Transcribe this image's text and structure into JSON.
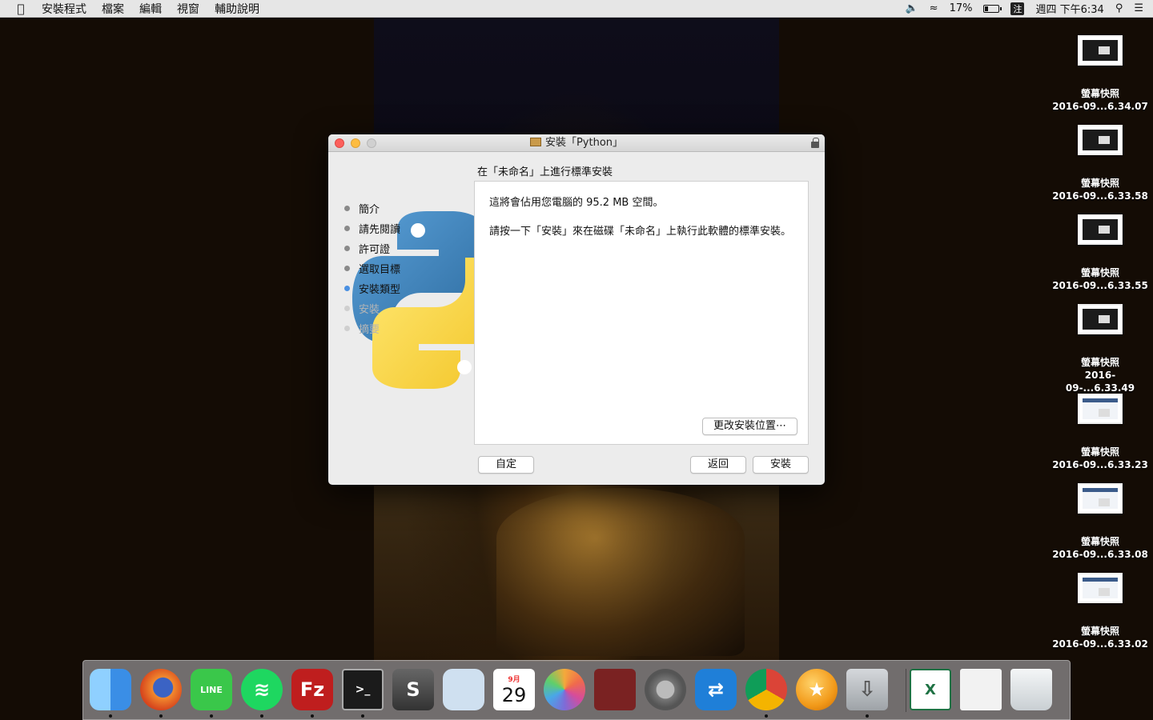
{
  "menubar": {
    "items": [
      "安裝程式",
      "檔案",
      "編輯",
      "視窗",
      "輔助說明"
    ],
    "battery_percent": "17%",
    "battery_level": 0.17,
    "ime_label": "注",
    "clock": "週四 下午6:34"
  },
  "desktop": {
    "icons": [
      {
        "name": "螢幕快照",
        "file": "2016-09...6.34.07",
        "style": "dark"
      },
      {
        "name": "螢幕快照",
        "file": "2016-09...6.33.58",
        "style": "dark"
      },
      {
        "name": "螢幕快照",
        "file": "2016-09...6.33.55",
        "style": "dark"
      },
      {
        "name": "螢幕快照",
        "file": "2016-09-...6.33.49",
        "style": "dark"
      },
      {
        "name": "螢幕快照",
        "file": "2016-09...6.33.23",
        "style": "light"
      },
      {
        "name": "螢幕快照",
        "file": "2016-09...6.33.08",
        "style": "light"
      },
      {
        "name": "螢幕快照",
        "file": "2016-09...6.33.02",
        "style": "light"
      }
    ]
  },
  "window": {
    "title": "安裝「Python」",
    "steps": [
      {
        "label": "簡介",
        "state": "done"
      },
      {
        "label": "請先閱讀",
        "state": "done"
      },
      {
        "label": "許可證",
        "state": "done"
      },
      {
        "label": "選取目標",
        "state": "done"
      },
      {
        "label": "安裝類型",
        "state": "active"
      },
      {
        "label": "安裝",
        "state": "pending"
      },
      {
        "label": "摘要",
        "state": "pending"
      }
    ],
    "heading": "在「未命名」上進行標準安裝",
    "body_line1": "這將會佔用您電腦的 95.2 MB 空間。",
    "body_line2": "請按一下「安裝」來在磁碟「未命名」上執行此軟體的標準安裝。",
    "change_location_button": "更改安裝位置⋯",
    "customize_button": "自定",
    "back_button": "返回",
    "install_button": "安裝"
  },
  "dock": {
    "apps": [
      {
        "name": "finder",
        "running": true
      },
      {
        "name": "firefox",
        "running": true
      },
      {
        "name": "line",
        "running": true
      },
      {
        "name": "spotify",
        "running": true
      },
      {
        "name": "filezilla",
        "running": true
      },
      {
        "name": "terminal",
        "running": true
      },
      {
        "name": "sublime-text",
        "running": false
      },
      {
        "name": "preview",
        "running": false
      },
      {
        "name": "calendar",
        "running": false
      },
      {
        "name": "photos",
        "running": false
      },
      {
        "name": "photo-booth",
        "running": false
      },
      {
        "name": "system-preferences",
        "running": false
      },
      {
        "name": "teamviewer",
        "running": false
      },
      {
        "name": "chrome",
        "running": true
      },
      {
        "name": "dragon-ball",
        "running": false
      },
      {
        "name": "installer",
        "running": true
      },
      {
        "name": "excel",
        "running": false
      },
      {
        "name": "document",
        "running": false
      },
      {
        "name": "trash",
        "running": false
      }
    ],
    "calendar_month": "9月",
    "calendar_day": "29",
    "colors": {
      "finder": "#3a8ee6",
      "firefox": "#e8642c",
      "line": "#3ac74a",
      "spotify": "#1ed760",
      "filezilla": "#bf1e1e",
      "terminal": "#1b1b1b",
      "sublime": "#4a4a4a",
      "preview": "#cfe0f0",
      "calendar": "#ffffff",
      "photos": "#f5f5f5",
      "photobooth": "#7a2222",
      "sysprefs": "#8c8c8c",
      "teamviewer": "#1f7fd8",
      "chrome": "#f4f4f4",
      "dragonball": "#f29a1a",
      "installer": "#b8bcc0",
      "excel": "#1f7244",
      "document": "#f2f2f2",
      "trash": "#dfe3e6"
    }
  }
}
